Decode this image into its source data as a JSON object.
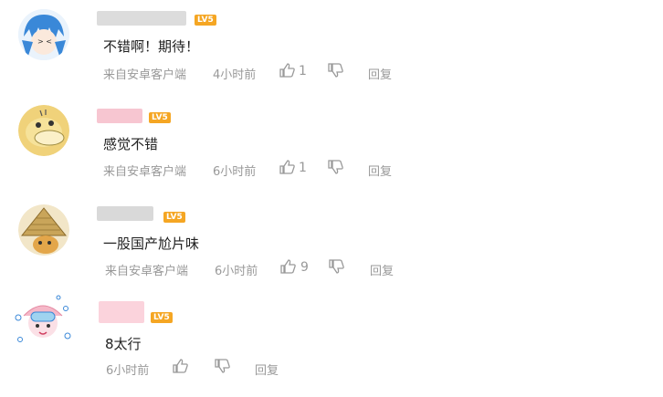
{
  "comments": [
    {
      "text": "不错啊！期待！",
      "source": "来自安卓客户端",
      "time": "4小时前",
      "likes": "1",
      "reply": "回复",
      "level": "LV5",
      "avatar_color": "#3a88d8",
      "name_color": "#dcdcdc"
    },
    {
      "text": "感觉不错",
      "source": "来自安卓客户端",
      "time": "6小时前",
      "likes": "1",
      "reply": "回复",
      "level": "LV5",
      "avatar_color": "#f0d27a",
      "name_color": "#f7c6d1"
    },
    {
      "text": "一股国产尬片味",
      "source": "来自安卓客户端",
      "time": "6小时前",
      "likes": "9",
      "reply": "回复",
      "level": "LV5",
      "avatar_color": "#c9a55a",
      "name_color": "#d9d9d9"
    },
    {
      "text": "8太行",
      "source": "",
      "time": "6小时前",
      "likes": "",
      "reply": "回复",
      "level": "LV5",
      "avatar_color": "#f5b8c8",
      "name_color": "#fbd3dc"
    }
  ]
}
